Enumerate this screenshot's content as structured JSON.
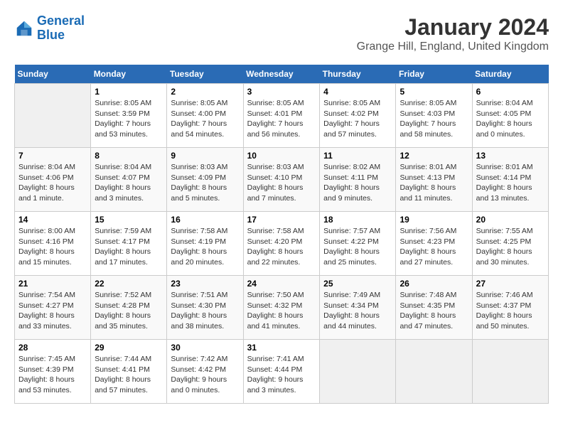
{
  "logo": {
    "line1": "General",
    "line2": "Blue"
  },
  "title": "January 2024",
  "subtitle": "Grange Hill, England, United Kingdom",
  "headers": [
    "Sunday",
    "Monday",
    "Tuesday",
    "Wednesday",
    "Thursday",
    "Friday",
    "Saturday"
  ],
  "weeks": [
    [
      {
        "num": "",
        "sunrise": "",
        "sunset": "",
        "daylight": ""
      },
      {
        "num": "1",
        "sunrise": "Sunrise: 8:05 AM",
        "sunset": "Sunset: 3:59 PM",
        "daylight": "Daylight: 7 hours and 53 minutes."
      },
      {
        "num": "2",
        "sunrise": "Sunrise: 8:05 AM",
        "sunset": "Sunset: 4:00 PM",
        "daylight": "Daylight: 7 hours and 54 minutes."
      },
      {
        "num": "3",
        "sunrise": "Sunrise: 8:05 AM",
        "sunset": "Sunset: 4:01 PM",
        "daylight": "Daylight: 7 hours and 56 minutes."
      },
      {
        "num": "4",
        "sunrise": "Sunrise: 8:05 AM",
        "sunset": "Sunset: 4:02 PM",
        "daylight": "Daylight: 7 hours and 57 minutes."
      },
      {
        "num": "5",
        "sunrise": "Sunrise: 8:05 AM",
        "sunset": "Sunset: 4:03 PM",
        "daylight": "Daylight: 7 hours and 58 minutes."
      },
      {
        "num": "6",
        "sunrise": "Sunrise: 8:04 AM",
        "sunset": "Sunset: 4:05 PM",
        "daylight": "Daylight: 8 hours and 0 minutes."
      }
    ],
    [
      {
        "num": "7",
        "sunrise": "Sunrise: 8:04 AM",
        "sunset": "Sunset: 4:06 PM",
        "daylight": "Daylight: 8 hours and 1 minute."
      },
      {
        "num": "8",
        "sunrise": "Sunrise: 8:04 AM",
        "sunset": "Sunset: 4:07 PM",
        "daylight": "Daylight: 8 hours and 3 minutes."
      },
      {
        "num": "9",
        "sunrise": "Sunrise: 8:03 AM",
        "sunset": "Sunset: 4:09 PM",
        "daylight": "Daylight: 8 hours and 5 minutes."
      },
      {
        "num": "10",
        "sunrise": "Sunrise: 8:03 AM",
        "sunset": "Sunset: 4:10 PM",
        "daylight": "Daylight: 8 hours and 7 minutes."
      },
      {
        "num": "11",
        "sunrise": "Sunrise: 8:02 AM",
        "sunset": "Sunset: 4:11 PM",
        "daylight": "Daylight: 8 hours and 9 minutes."
      },
      {
        "num": "12",
        "sunrise": "Sunrise: 8:01 AM",
        "sunset": "Sunset: 4:13 PM",
        "daylight": "Daylight: 8 hours and 11 minutes."
      },
      {
        "num": "13",
        "sunrise": "Sunrise: 8:01 AM",
        "sunset": "Sunset: 4:14 PM",
        "daylight": "Daylight: 8 hours and 13 minutes."
      }
    ],
    [
      {
        "num": "14",
        "sunrise": "Sunrise: 8:00 AM",
        "sunset": "Sunset: 4:16 PM",
        "daylight": "Daylight: 8 hours and 15 minutes."
      },
      {
        "num": "15",
        "sunrise": "Sunrise: 7:59 AM",
        "sunset": "Sunset: 4:17 PM",
        "daylight": "Daylight: 8 hours and 17 minutes."
      },
      {
        "num": "16",
        "sunrise": "Sunrise: 7:58 AM",
        "sunset": "Sunset: 4:19 PM",
        "daylight": "Daylight: 8 hours and 20 minutes."
      },
      {
        "num": "17",
        "sunrise": "Sunrise: 7:58 AM",
        "sunset": "Sunset: 4:20 PM",
        "daylight": "Daylight: 8 hours and 22 minutes."
      },
      {
        "num": "18",
        "sunrise": "Sunrise: 7:57 AM",
        "sunset": "Sunset: 4:22 PM",
        "daylight": "Daylight: 8 hours and 25 minutes."
      },
      {
        "num": "19",
        "sunrise": "Sunrise: 7:56 AM",
        "sunset": "Sunset: 4:23 PM",
        "daylight": "Daylight: 8 hours and 27 minutes."
      },
      {
        "num": "20",
        "sunrise": "Sunrise: 7:55 AM",
        "sunset": "Sunset: 4:25 PM",
        "daylight": "Daylight: 8 hours and 30 minutes."
      }
    ],
    [
      {
        "num": "21",
        "sunrise": "Sunrise: 7:54 AM",
        "sunset": "Sunset: 4:27 PM",
        "daylight": "Daylight: 8 hours and 33 minutes."
      },
      {
        "num": "22",
        "sunrise": "Sunrise: 7:52 AM",
        "sunset": "Sunset: 4:28 PM",
        "daylight": "Daylight: 8 hours and 35 minutes."
      },
      {
        "num": "23",
        "sunrise": "Sunrise: 7:51 AM",
        "sunset": "Sunset: 4:30 PM",
        "daylight": "Daylight: 8 hours and 38 minutes."
      },
      {
        "num": "24",
        "sunrise": "Sunrise: 7:50 AM",
        "sunset": "Sunset: 4:32 PM",
        "daylight": "Daylight: 8 hours and 41 minutes."
      },
      {
        "num": "25",
        "sunrise": "Sunrise: 7:49 AM",
        "sunset": "Sunset: 4:34 PM",
        "daylight": "Daylight: 8 hours and 44 minutes."
      },
      {
        "num": "26",
        "sunrise": "Sunrise: 7:48 AM",
        "sunset": "Sunset: 4:35 PM",
        "daylight": "Daylight: 8 hours and 47 minutes."
      },
      {
        "num": "27",
        "sunrise": "Sunrise: 7:46 AM",
        "sunset": "Sunset: 4:37 PM",
        "daylight": "Daylight: 8 hours and 50 minutes."
      }
    ],
    [
      {
        "num": "28",
        "sunrise": "Sunrise: 7:45 AM",
        "sunset": "Sunset: 4:39 PM",
        "daylight": "Daylight: 8 hours and 53 minutes."
      },
      {
        "num": "29",
        "sunrise": "Sunrise: 7:44 AM",
        "sunset": "Sunset: 4:41 PM",
        "daylight": "Daylight: 8 hours and 57 minutes."
      },
      {
        "num": "30",
        "sunrise": "Sunrise: 7:42 AM",
        "sunset": "Sunset: 4:42 PM",
        "daylight": "Daylight: 9 hours and 0 minutes."
      },
      {
        "num": "31",
        "sunrise": "Sunrise: 7:41 AM",
        "sunset": "Sunset: 4:44 PM",
        "daylight": "Daylight: 9 hours and 3 minutes."
      },
      {
        "num": "",
        "sunrise": "",
        "sunset": "",
        "daylight": ""
      },
      {
        "num": "",
        "sunrise": "",
        "sunset": "",
        "daylight": ""
      },
      {
        "num": "",
        "sunrise": "",
        "sunset": "",
        "daylight": ""
      }
    ]
  ]
}
